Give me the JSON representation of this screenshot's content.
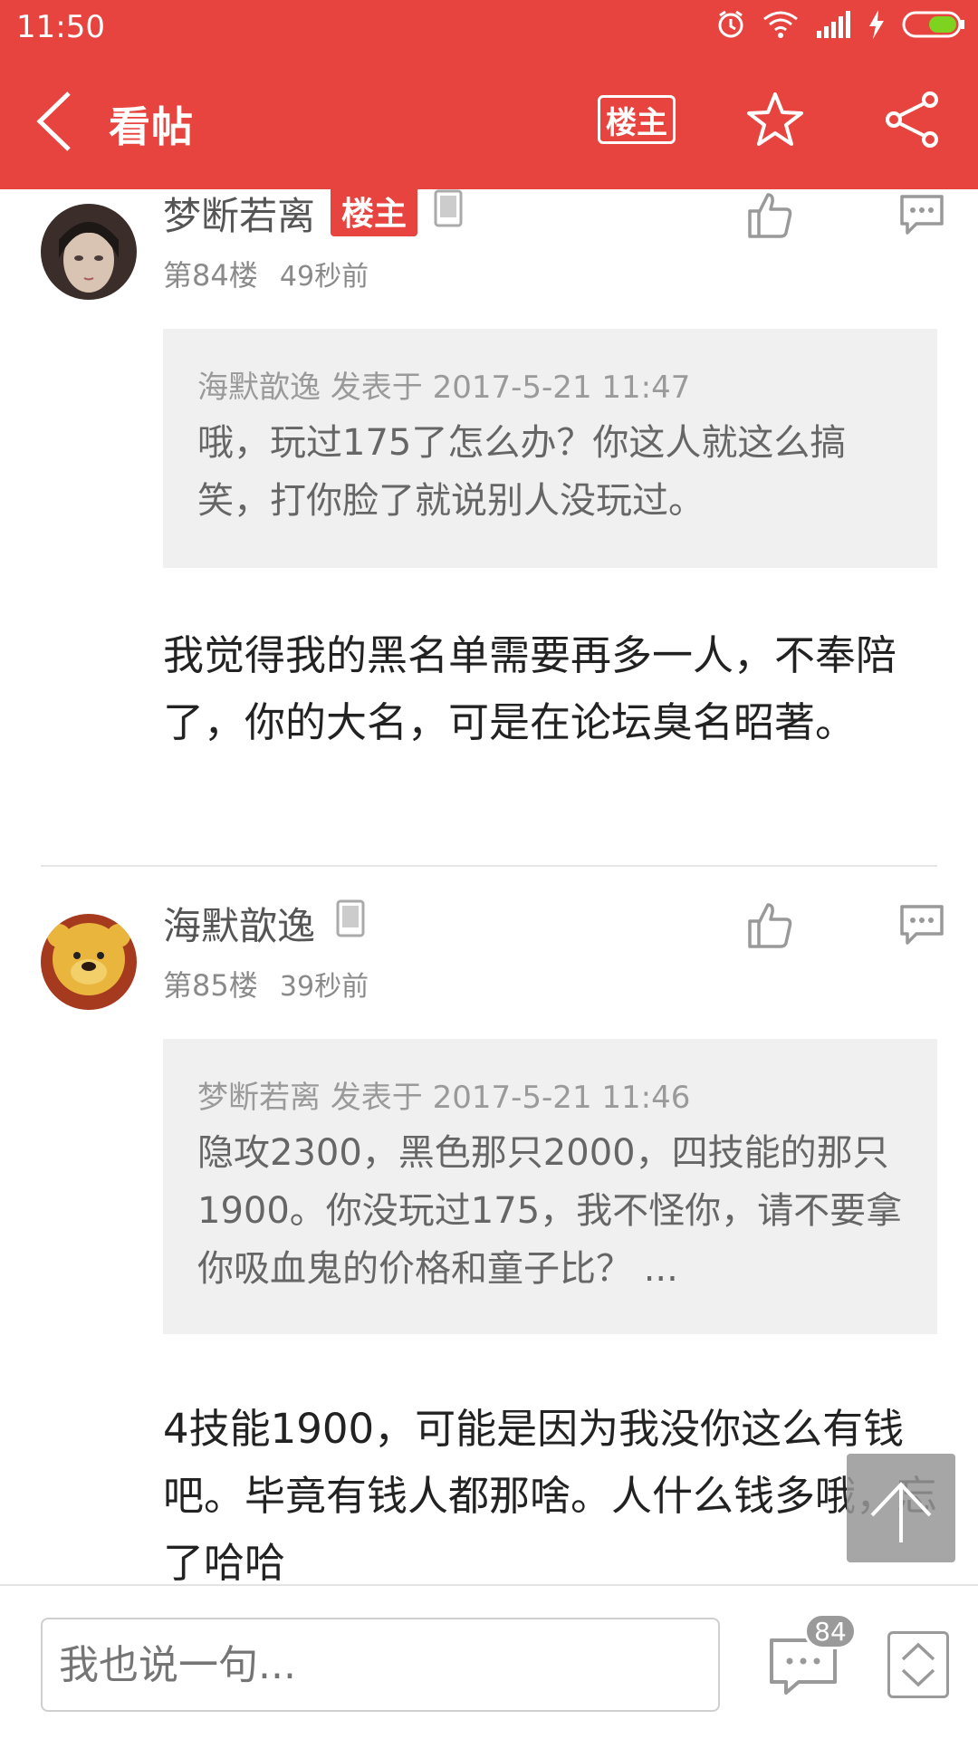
{
  "status_bar": {
    "time": "11:50",
    "icons": [
      "alarm-icon",
      "wifi-icon",
      "signal-icon",
      "charging-icon",
      "battery-icon"
    ]
  },
  "header": {
    "title": "看帖",
    "owner_filter_label": "楼主",
    "bg_color": "#e8443f"
  },
  "posts": [
    {
      "author": "梦断若离",
      "owner_badge": "楼主",
      "floor": "第84楼",
      "time": "49秒前",
      "quote": {
        "head": "海默歆逸 发表于 2017-5-21 11:47",
        "body": "哦，玩过175了怎么办？你这人就这么搞笑，打你脸了就说别人没玩过。"
      },
      "body": "我觉得我的黑名单需要再多一人，不奉陪了，你的大名，可是在论坛臭名昭著。"
    },
    {
      "author": "海默歆逸",
      "floor": "第85楼",
      "time": "39秒前",
      "quote": {
        "head": "梦断若离 发表于 2017-5-21 11:46",
        "body": "隐攻2300，黑色那只2000，四技能的那只1900。你没玩过175，我不怪你，请不要拿你吸血鬼的价格和童子比？ ..."
      },
      "body": "4技能1900，可能是因为我没你这么有钱吧。毕竟有钱人都那啥。人什么钱多哦，忘了哈哈"
    }
  ],
  "bottom_bar": {
    "input_placeholder": "我也说一句...",
    "comment_count": "84"
  }
}
